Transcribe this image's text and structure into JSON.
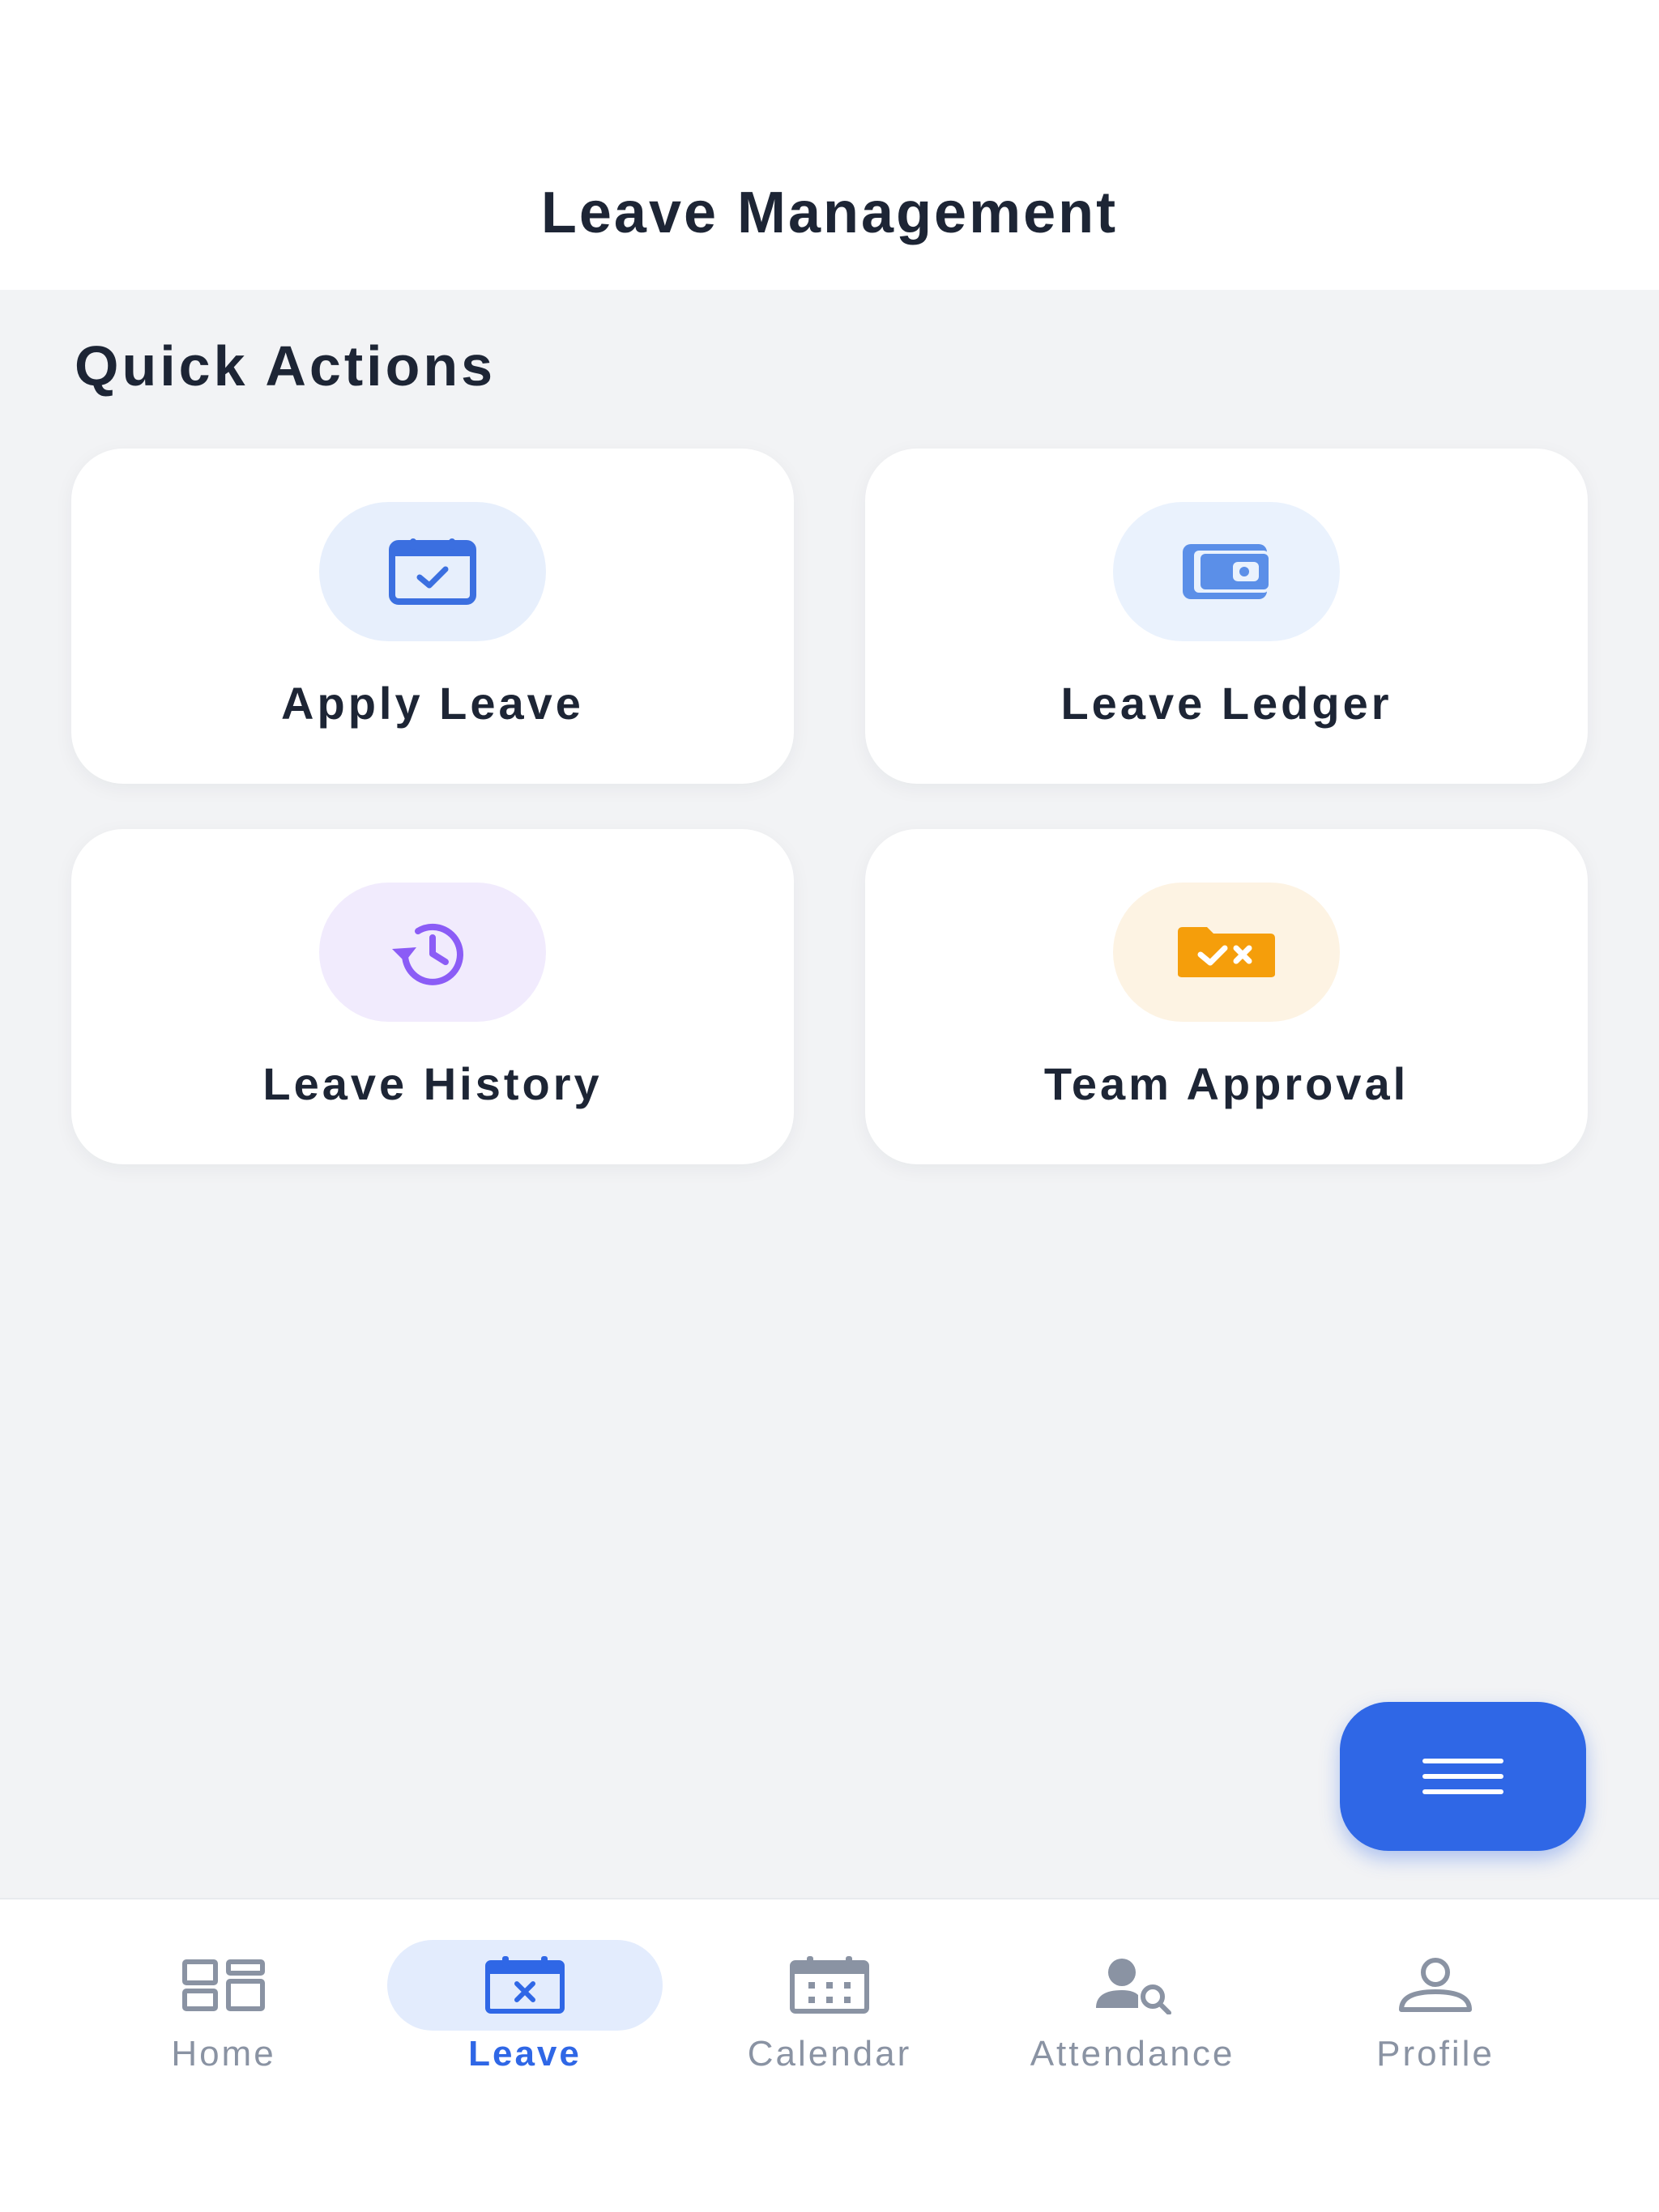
{
  "header": {
    "title": "Leave Management"
  },
  "quick_actions": {
    "title": "Quick Actions",
    "cards": [
      {
        "label": "Apply Leave",
        "icon": "calendar-check-icon",
        "color": "#3b6fe0",
        "bg": "#e7effc"
      },
      {
        "label": "Leave Ledger",
        "icon": "wallet-icon",
        "color": "#5b8fe8",
        "bg": "#eaf2fd"
      },
      {
        "label": "Leave History",
        "icon": "history-clock-icon",
        "color": "#8b5cf6",
        "bg": "#f1ebfd"
      },
      {
        "label": "Team Approval",
        "icon": "approval-folder-icon",
        "color": "#f59e0b",
        "bg": "#fdf3e3"
      }
    ]
  },
  "fab": {
    "icon": "menu-icon",
    "color": "#2f67e6"
  },
  "bottom_nav": {
    "active": "Leave",
    "active_color": "#2f67e6",
    "items": [
      {
        "label": "Home",
        "icon": "dashboard-grid-icon"
      },
      {
        "label": "Leave",
        "icon": "calendar-x-icon"
      },
      {
        "label": "Calendar",
        "icon": "calendar-icon"
      },
      {
        "label": "Attendance",
        "icon": "user-search-icon"
      },
      {
        "label": "Profile",
        "icon": "person-icon"
      }
    ]
  }
}
